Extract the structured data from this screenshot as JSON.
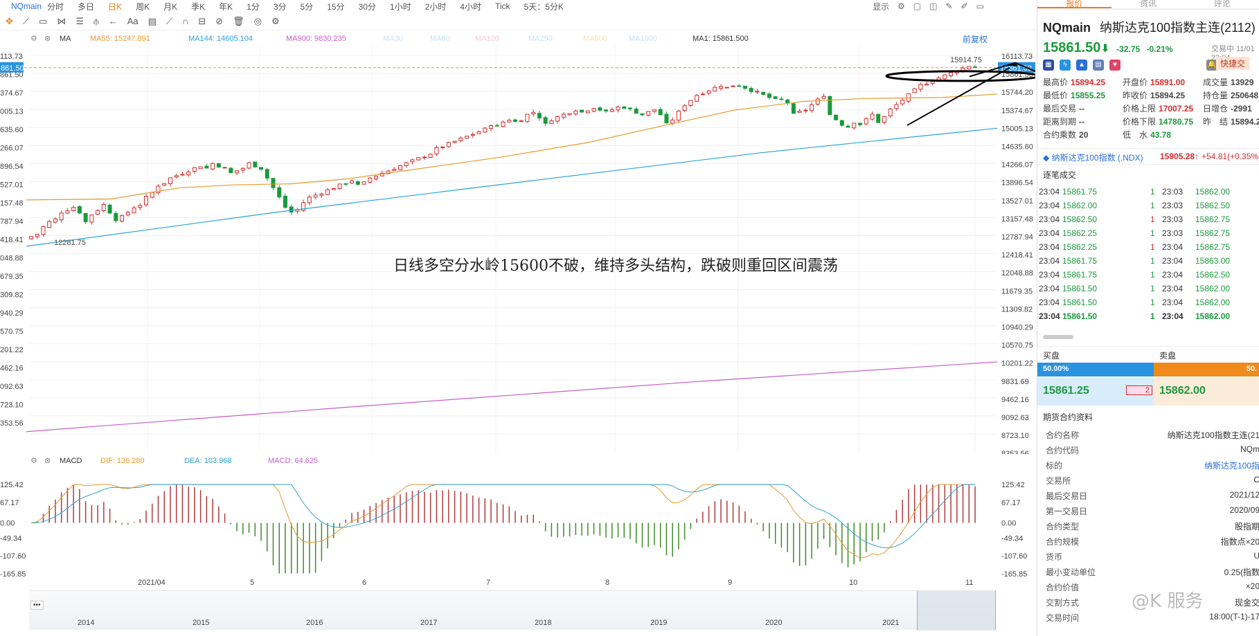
{
  "symbol": "NQmain",
  "periods": [
    "分时",
    "多日",
    "日K",
    "周K",
    "月K",
    "季K",
    "年K",
    "1分",
    "3分",
    "5分",
    "15分",
    "30分",
    "1小时",
    "2小时",
    "4小时",
    "Tick",
    "5天：5分K"
  ],
  "active_period": "日K",
  "top_right": {
    "display_label": "显示"
  },
  "ma_legend": [
    {
      "label": "MA",
      "color": "#333333"
    },
    {
      "label": "MA55: 15247.891",
      "color": "#e59a2c"
    },
    {
      "label": "MA144: 14605.104",
      "color": "#2aa3d6"
    },
    {
      "label": "MA900: 9830.235",
      "color": "#c65fc6"
    },
    {
      "label": "MA30",
      "color": "#c8e2f3"
    },
    {
      "label": "MA60",
      "color": "#c8e2f3"
    },
    {
      "label": "MA120",
      "color": "#f4c9d3"
    },
    {
      "label": "MA250",
      "color": "#c8e2f3"
    },
    {
      "label": "MA500",
      "color": "#f4e1b5"
    },
    {
      "label": "MA1000",
      "color": "#c8e2f3"
    },
    {
      "label": "MA1: 15861.500",
      "color": "#333333"
    }
  ],
  "restore_label": "前复权",
  "price_axis_left": [
    "113.73",
    "861.50",
    "374.67",
    "005.13",
    "635.60",
    "266.07",
    "896.54",
    "527.01",
    "157.48",
    "787.94",
    "418.41",
    "048.88",
    "679.35",
    "309.82",
    "940.29",
    "570.75",
    "201.22",
    "462.16",
    "092.63",
    "723.10",
    "353.56"
  ],
  "price_axis_right": [
    "16113.73",
    "15861.50",
    "15744.20",
    "15374.67",
    "15005.13",
    "14635.60",
    "14266.07",
    "13896.54",
    "13527.01",
    "13157.48",
    "12787.94",
    "12418.41",
    "12048.88",
    "11679.35",
    "11309.82",
    "10940.29",
    "10570.75",
    "10201.22",
    "9831.69",
    "9462.16",
    "9092.63",
    "8723.10",
    "8353.56"
  ],
  "high_label": "15914.75",
  "low_label": "12281.75",
  "annotation": "日线多空分水岭15600不破，维持多头结构，跌破则重回区间震荡",
  "macd_legend": [
    {
      "label": "MACD",
      "color": "#333333"
    },
    {
      "label": "DIF: 136.280",
      "color": "#e59a2c"
    },
    {
      "label": "DEA: 103.968",
      "color": "#2aa3d6"
    },
    {
      "label": "MACD: 64.625",
      "color": "#c65fc6"
    }
  ],
  "macd_axis": [
    "125.42",
    "67.17",
    "0.00",
    "-49.34",
    "-107.60",
    "-165.85"
  ],
  "month_labels": [
    "2021/04",
    "5",
    "6",
    "7",
    "8",
    "9",
    "10",
    "11"
  ],
  "year_labels": [
    "2014",
    "2015",
    "2016",
    "2017",
    "2018",
    "2019",
    "2020",
    "2021"
  ],
  "colors": {
    "up": "#d12b2b",
    "down": "#1a9a3c",
    "ma55": "#e59a2c",
    "ma144": "#2aa3d6",
    "ma900": "#c65fc6",
    "accent": "#e67e22",
    "link": "#2a6fd8"
  },
  "panel": {
    "tabs": [
      "报价",
      "资讯",
      "评论"
    ],
    "title_code": "NQmain",
    "title_name": "纳斯达克100指数主连(2112)",
    "price": "15861.50",
    "change": "-32.75",
    "change_pct": "-0.21%",
    "time": "交易中 11/01 23:04",
    "fast_btn": "快捷交",
    "quote_rows": [
      [
        {
          "k": "最高价",
          "v": "15894.25",
          "c": "red"
        },
        {
          "k": "开盘价",
          "v": "15891.00",
          "c": "red"
        },
        {
          "k": "成交量",
          "v": "13929",
          "c": ""
        }
      ],
      [
        {
          "k": "最低价",
          "v": "15855.25",
          "c": "green"
        },
        {
          "k": "昨收价",
          "v": "15894.25",
          "c": ""
        },
        {
          "k": "持仓量",
          "v": "250648",
          "c": ""
        }
      ],
      [
        {
          "k": "最后交易",
          "v": "--",
          "c": ""
        },
        {
          "k": "价格上限",
          "v": "17007.25",
          "c": "red"
        },
        {
          "k": "日增仓",
          "v": "-2991",
          "c": ""
        }
      ],
      [
        {
          "k": "距离到期",
          "v": "--",
          "c": ""
        },
        {
          "k": "价格下限",
          "v": "14780.75",
          "c": "green"
        },
        {
          "k": "昨　结",
          "v": "15894.2",
          "c": ""
        }
      ],
      [
        {
          "k": "合约乘数",
          "v": "20",
          "c": ""
        },
        {
          "k": "低　水",
          "v": "43.78",
          "c": "green"
        },
        {
          "k": "",
          "v": "",
          "c": ""
        }
      ]
    ],
    "ndx_name": "纳斯达克100指数 (.NDX)",
    "ndx_price": "15905.28↑",
    "ndx_change": "+54.81(+0.35%)",
    "ticks_title": "逐笔成交",
    "ticks": [
      [
        "23:04",
        "15861.75",
        "1",
        "23:03",
        "15862.00"
      ],
      [
        "23:04",
        "15862.00",
        "1",
        "23:03",
        "15862.50"
      ],
      [
        "23:04",
        "15862.50",
        "1",
        "23:03",
        "15862.75"
      ],
      [
        "23:04",
        "15862.25",
        "1",
        "23:03",
        "15862.75"
      ],
      [
        "23:04",
        "15862.25",
        "1",
        "23:04",
        "15862.75"
      ],
      [
        "23:04",
        "15861.75",
        "1",
        "23:04",
        "15863.00"
      ],
      [
        "23:04",
        "15861.75",
        "1",
        "23:04",
        "15862.50"
      ],
      [
        "23:04",
        "15861.50",
        "1",
        "23:04",
        "15862.00"
      ],
      [
        "23:04",
        "15861.50",
        "1",
        "23:04",
        "15862.00"
      ],
      [
        "23:04",
        "15861.50",
        "1",
        "23:04",
        "15862.00"
      ]
    ],
    "ob_buy_label": "买盘",
    "ob_sell_label": "卖盘",
    "ob_buy_pct": "50.00%",
    "ob_sell_pct": "50.",
    "ob_buy_price": "15861.25",
    "ob_buy_qty": "2",
    "ob_sell_price": "15862.00",
    "spec_title": "期货合约资料",
    "spec": [
      {
        "k": "合约名称",
        "v": "纳斯达克100指数主连(21",
        "link": false
      },
      {
        "k": "合约代码",
        "v": "NQm",
        "link": false
      },
      {
        "k": "标的",
        "v": "纳斯达克100指",
        "link": true
      },
      {
        "k": "交易所",
        "v": "C",
        "link": false
      },
      {
        "k": "最后交易日",
        "v": "2021/12",
        "link": false
      },
      {
        "k": "第一交易日",
        "v": "2020/09",
        "link": false
      },
      {
        "k": "合约类型",
        "v": "股指期",
        "link": false
      },
      {
        "k": "合约规模",
        "v": "指数点×20",
        "link": false
      },
      {
        "k": "货币",
        "v": "U",
        "link": false
      },
      {
        "k": "最小变动单位",
        "v": "0.25(指数",
        "link": false
      },
      {
        "k": "合约价值",
        "v": "×20",
        "link": false
      },
      {
        "k": "交割方式",
        "v": "现金交",
        "link": false
      },
      {
        "k": "交易时间",
        "v": "18:00(T-1)-17",
        "link": false
      }
    ]
  },
  "watermark": "@K 服务"
}
